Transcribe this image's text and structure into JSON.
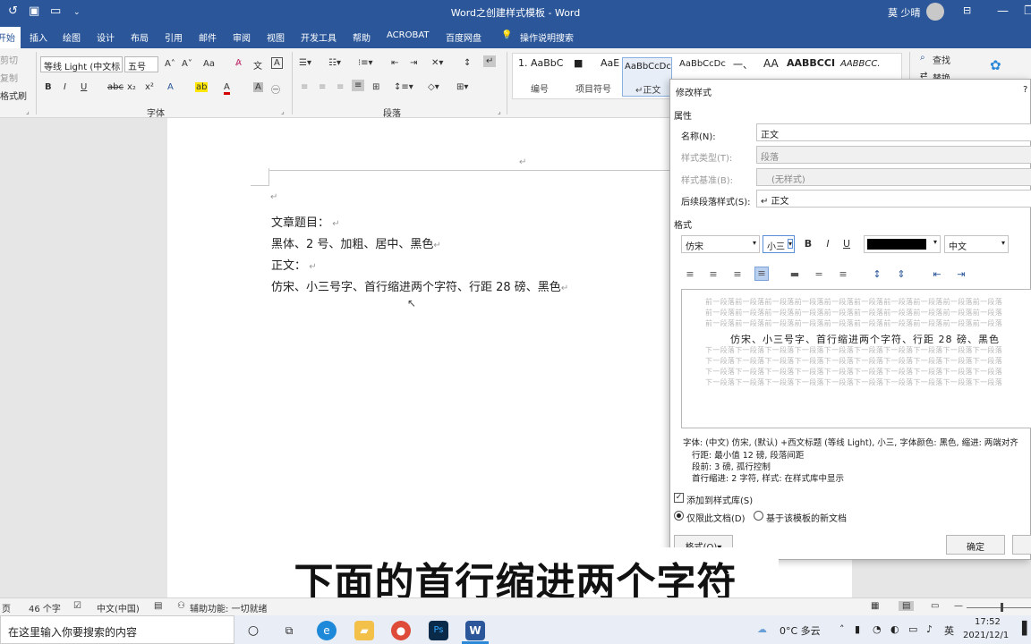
{
  "window": {
    "title": "Word之创建样式模板 - Word",
    "user": "莫 少晴"
  },
  "ribbon_tabs": [
    "开始",
    "插入",
    "绘图",
    "设计",
    "布局",
    "引用",
    "邮件",
    "审阅",
    "视图",
    "开发工具",
    "帮助",
    "ACROBAT",
    "百度网盘",
    "操作说明搜索"
  ],
  "clipboard": {
    "cut": "剪切",
    "copy": "复制",
    "format_painter": "格式刷"
  },
  "font_group": {
    "font_name": "等线 Light (中文标",
    "font_size": "五号",
    "label": "字体",
    "case_btn": "Aa"
  },
  "paragraph_group": {
    "label": "段落"
  },
  "styles_gallery": [
    {
      "preview": "1. AaBbC",
      "label": "编号"
    },
    {
      "preview": "■",
      "label": "项目符号"
    },
    {
      "preview": "AaE",
      "label": ""
    },
    {
      "preview": "AaBbCcDc",
      "label": "↵正文"
    },
    {
      "preview": "AaBbCcDc",
      "label": ""
    },
    {
      "preview": "一、",
      "label": ""
    },
    {
      "preview": "AA",
      "label": ""
    },
    {
      "preview": "AABBCCI",
      "label": ""
    },
    {
      "preview": "AABBCC.",
      "label": ""
    }
  ],
  "editing": {
    "find": "查找",
    "replace": "替换"
  },
  "document": {
    "lines": [
      "文章题目：",
      "黑体、2 号、加粗、居中、黑色",
      "正文：",
      "仿宋、小三号字、首行缩进两个字符、行距 28 磅、黑色"
    ]
  },
  "dialog": {
    "title": "修改样式",
    "help": "?",
    "section_props": "属性",
    "name_label": "名称(N):",
    "name_value": "正文",
    "type_label": "样式类型(T):",
    "type_value": "段落",
    "based_label": "样式基准(B):",
    "based_value": "(无样式)",
    "next_label": "后续段落样式(S):",
    "next_value": "↵ 正文",
    "section_format": "格式",
    "font": "仿宋",
    "size": "小三",
    "bold": "B",
    "italic": "I",
    "underline": "U",
    "color_hex": "#000000",
    "lang": "中文",
    "preview_prev": "前一段落前一段落前一段落前一段落前一段落前一段落前一段落前一段落前一段落前一段落",
    "preview_main": "仿宋、小三号字、首行缩进两个字符、行距 28 磅、黑色",
    "preview_next": "下一段落下一段落下一段落下一段落下一段落下一段落下一段落下一段落下一段落下一段落",
    "description_lines": [
      "字体: (中文) 仿宋, (默认) +西文标题 (等线 Light), 小三, 字体颜色: 黑色, 缩进: 两端对齐",
      "行距: 最小值 12 磅, 段落间距",
      "段前: 3 磅, 孤行控制",
      "首行缩进:  2 字符, 样式: 在样式库中显示"
    ],
    "add_to_gallery": "添加到样式库(S)",
    "only_this_doc": "仅限此文档(D)",
    "template_docs": "基于该模板的新文档",
    "format_button": "格式(O)▾",
    "ok_button": "确定"
  },
  "caption": "下面的首行缩进两个字符",
  "statusbar": {
    "pages": "页",
    "words": "46 个字",
    "lang": "中文(中国)",
    "accessibility": "辅助功能: 一切就绪"
  },
  "taskbar": {
    "search_placeholder": "在这里输入你要搜索的内容",
    "weather": "0°C 多云",
    "ime": "英",
    "time": "17:52",
    "date": "2021/12/1"
  },
  "colors": {
    "word_blue": "#2b579a",
    "caption_bg": "#ffffff"
  }
}
